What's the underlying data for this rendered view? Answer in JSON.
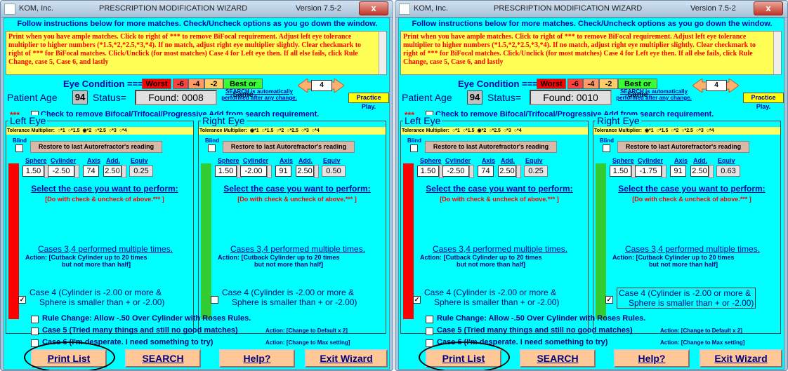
{
  "common": {
    "company": "KOM, Inc.",
    "title": "PRESCRIPTION MODIFICATION WIZARD",
    "version": "Version 7.5-2",
    "close_glyph": "x",
    "app_icon": "icon",
    "instructions_title": "Follow instructions below for more matches. Check/Uncheck options as you go down the window.",
    "instructions_text": "Print when you have ample matches. Click to right of *** to remove BiFocal requirement. Adjust left eye tolerance multiplier to higher numbers (*1.5,*2,*2.5,*3,*4). If no match, adjust right eye multiplier slightly. Clear checkmark to right of *** for BiFocal matches. Click/Unclick (for most matches) Case 4 for Left eye then. If all else fails, click Rule Change, case 5, Case 6, and lastly",
    "eye_condition_label": "Eye Condition ===>",
    "scale": [
      {
        "label": "Worst",
        "bg": "#ff0000"
      },
      {
        "label": "-6",
        "bg": "#ff4040"
      },
      {
        "label": "-4",
        "bg": "#ff9966"
      },
      {
        "label": "-2",
        "bg": "#ffcc66"
      },
      {
        "label": "Best or Same",
        "bg": "#33ff33"
      }
    ],
    "patient_age_label": "Patient Age",
    "patient_age": "94",
    "status_label": "Status=",
    "search_note": "SEARCH is automatically performed after any change.",
    "arrow_value": "4",
    "practice_play": "Practice Play.",
    "stars": "***",
    "bifocal_text": "Check to remove Bifocal/Trifocal/Progressive Add from search requirement.",
    "left_eye": "Left Eye",
    "right_eye": "Right Eye",
    "tolerance_label": "Tolerance Multiplier:",
    "tolerance_options": [
      "*1",
      "*1.5",
      "*2",
      "*2.5",
      "*3",
      "*4"
    ],
    "blind": "Blind",
    "restore": "Restore to last Autorefractor's reading",
    "rx_headers": [
      "Sphere",
      "Cylinder",
      "Axis",
      "Add.",
      "Equiv"
    ],
    "select_case": "Select the case you want to perform:",
    "select_sub": "[Do with check & uncheck of above.*** ]",
    "cases34": "Cases 3,4 performed multiple times.",
    "cases34_action": "Action: [Cutback Cylinder up to 20 times",
    "cases34_action2": "but not more than half]",
    "case4_line1": "Case 4 (Cylinder is -2.00 or more &",
    "case4_line2": "Sphere is smaller than + or -2.00)",
    "rule_change": "Rule Change: Allow -.50 Over Cylinder with Roses Rules.",
    "case5": "Case 5 (Tried many things and still no good matches)",
    "case5_action": "Action: [Change to Default x 2]",
    "case6": "Case 6 (I'm desperate. I need something to try)",
    "case6_action": "Action: [Change to Max setting]",
    "buttons": {
      "print": "Print List",
      "search": "SEARCH",
      "help": "Help?",
      "exit": "Exit Wizard"
    },
    "colors": {
      "client": "#00ffff",
      "left_bar": "#ff0000",
      "right_bar": "#33cc33",
      "button": "#ffc896"
    }
  },
  "windows": [
    {
      "status": "Found:  0008",
      "left": {
        "tol_selected": "*2",
        "rx": [
          "1.50",
          "-2.50",
          "74",
          "2.50",
          "0.25"
        ]
      },
      "right": {
        "tol_selected": "*1",
        "rx": [
          "1.50",
          "-2.00",
          "91",
          "2.50",
          "0.50"
        ]
      },
      "case4_left": true,
      "case4_right": false
    },
    {
      "status": "Found:  0010",
      "left": {
        "tol_selected": "*2",
        "rx": [
          "1.50",
          "-2.50",
          "74",
          "2.50",
          "0.25"
        ]
      },
      "right": {
        "tol_selected": "*1",
        "rx": [
          "1.50",
          "-1.75",
          "91",
          "2.50",
          "0.63"
        ]
      },
      "case4_left": true,
      "case4_right": true
    }
  ]
}
